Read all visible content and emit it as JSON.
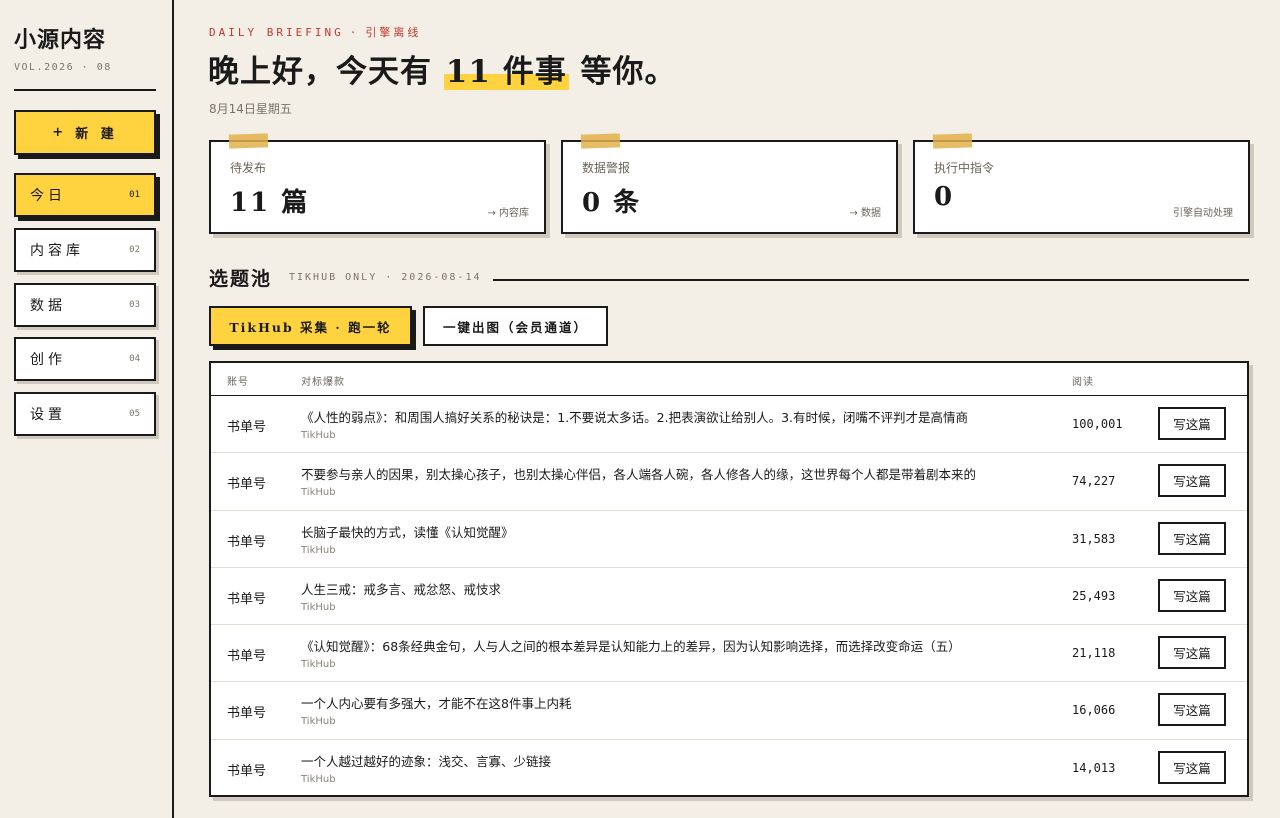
{
  "sidebar": {
    "brand": "小源内容",
    "volume": "VOL.2026 · 08",
    "new_button": {
      "icon": "+",
      "label": "新 建"
    },
    "nav": [
      {
        "label": "今日",
        "num": "01",
        "active": true
      },
      {
        "label": "内容库",
        "num": "02",
        "active": false
      },
      {
        "label": "数据",
        "num": "03",
        "active": false
      },
      {
        "label": "创作",
        "num": "04",
        "active": false
      },
      {
        "label": "设置",
        "num": "05",
        "active": false
      }
    ]
  },
  "header": {
    "kicker_en": "DAILY BRIEFING",
    "kicker_sep": "·",
    "kicker_cn": "引擎离线",
    "headline_pre": "晚上好，今天有",
    "headline_highlight": "11 件事",
    "headline_post": "等你。",
    "date": "8月14日星期五"
  },
  "stats": [
    {
      "label": "待发布",
      "value": "11 篇",
      "link": "→ 内容库"
    },
    {
      "label": "数据警报",
      "value": "0 条",
      "link": "→ 数据"
    },
    {
      "label": "执行中指令",
      "value": "0",
      "link": "引擎自动处理"
    }
  ],
  "topics": {
    "title": "选题池",
    "subtitle": "TIKHUB ONLY · 2026-08-14",
    "run_button": "TikHub 采集 · 跑一轮",
    "image_button": "一键出图（会员通道）",
    "columns": {
      "account": "账号",
      "title": "对标爆款",
      "reads": "阅读"
    },
    "rows": [
      {
        "account": "书单号",
        "title": "《人性的弱点》：和周围人搞好关系的秘诀是：1.不要说太多话。2.把表演欲让给别人。3.有时候，闭嘴不评判才是高情商",
        "source": "TikHub",
        "reads": "100,001",
        "action": "写这篇"
      },
      {
        "account": "书单号",
        "title": "不要参与亲人的因果，别太操心孩子，也别太操心伴侣，各人端各人碗，各人修各人的缘，这世界每个人都是带着剧本来的",
        "source": "TikHub",
        "reads": "74,227",
        "action": "写这篇"
      },
      {
        "account": "书单号",
        "title": "长脑子最快的方式，读懂《认知觉醒》",
        "source": "TikHub",
        "reads": "31,583",
        "action": "写这篇"
      },
      {
        "account": "书单号",
        "title": "人生三戒：戒多言、戒忿怒、戒忮求",
        "source": "TikHub",
        "reads": "25,493",
        "action": "写这篇"
      },
      {
        "account": "书单号",
        "title": "《认知觉醒》：68条经典金句，人与人之间的根本差异是认知能力上的差异，因为认知影响选择，而选择改变命运（五）",
        "source": "TikHub",
        "reads": "21,118",
        "action": "写这篇"
      },
      {
        "account": "书单号",
        "title": "一个人内心要有多强大，才能不在这8件事上内耗",
        "source": "TikHub",
        "reads": "16,066",
        "action": "写这篇"
      },
      {
        "account": "书单号",
        "title": "一个人越过越好的迹象：浅交、言寡、少链接",
        "source": "TikHub",
        "reads": "14,013",
        "action": "写这篇"
      }
    ]
  },
  "colors": {
    "accent": "#ffd23f",
    "background": "#f3efe7",
    "ink": "#1a1a1a",
    "alert": "#c0392b",
    "tape": "#e3b04b"
  }
}
